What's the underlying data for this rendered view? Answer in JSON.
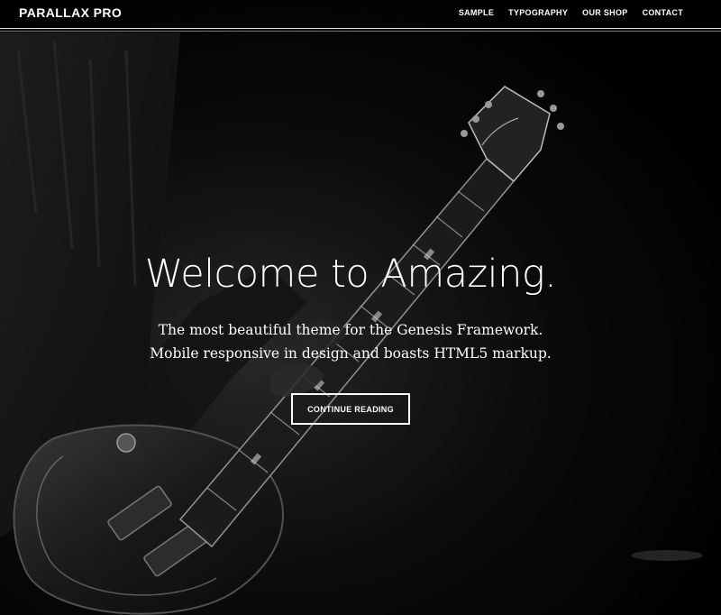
{
  "header": {
    "site_title": "PARALLAX PRO",
    "nav": [
      "SAMPLE",
      "TYPOGRAPHY",
      "OUR SHOP",
      "CONTACT"
    ]
  },
  "hero": {
    "title": "Welcome to Amazing.",
    "text_line1": "The most beautiful theme for the Genesis Framework.",
    "text_line2": "Mobile responsive in design and boasts HTML5 markup.",
    "button_label": "CONTINUE READING",
    "photo_subject": "guitarist-playing-electric-guitar"
  },
  "colors": {
    "background": "#000000",
    "text": "#ffffff"
  }
}
